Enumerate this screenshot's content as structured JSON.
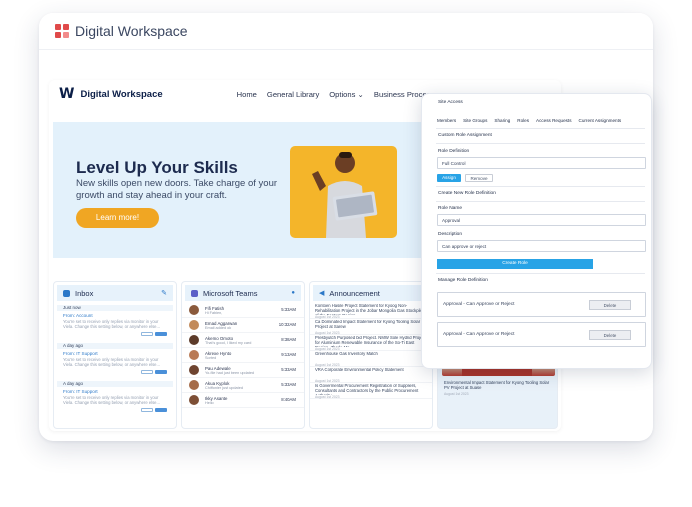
{
  "window": {
    "title": "Digital Workspace"
  },
  "nav": {
    "brand": "Digital Workspace",
    "links": [
      "Home",
      "General Library",
      "Options",
      "Business Processes"
    ]
  },
  "hero": {
    "title": "Level Up Your Skills",
    "subtitle": "New skills open new doors. Take charge of your growth and stay ahead in your craft.",
    "cta": "Learn more!"
  },
  "inbox": {
    "title": "Inbox",
    "groups": [
      {
        "header": "Just now",
        "from": "From: Account",
        "text": "You're set to receive only replies via monitor in your Viela. Change this setting below, or anywhere else..."
      },
      {
        "header": "A day ago",
        "from": "From: IT Support",
        "text": "You're set to receive only replies via monitor in your Viela. Change this setting below, or anywhere else..."
      },
      {
        "header": "A day ago",
        "from": "From: IT Support",
        "text": "You're set to receive only replies via monitor in your Viela. Change this setting below, or anywhere else..."
      }
    ]
  },
  "teams": {
    "title": "Microsoft Teams",
    "items": [
      {
        "name": "Fifi Fatish",
        "status": "Hi Fabien,",
        "time": "5:33AM"
      },
      {
        "name": "Emad Aggarwan",
        "status": "Email added ok",
        "time": "10:32AM"
      },
      {
        "name": "Akemo Omoto",
        "status": "That's good, I liked my card",
        "time": "8:38AM"
      },
      {
        "name": "Akrexe Hynto",
        "status": "Sorted",
        "time": "9:13AM"
      },
      {
        "name": "Pau Adewale",
        "status": "Yo-file had just been updated",
        "time": "5:33AM"
      },
      {
        "name": "Akua Kyplok",
        "status": "Chiffonier just updated",
        "time": "5:33AM"
      },
      {
        "name": "Ikky Asante",
        "status": "Hello",
        "time": "8:40AM"
      }
    ]
  },
  "announcement": {
    "title": "Announcement",
    "items": [
      {
        "text": "Kontoen Hasile Project Statement for Kyoog Non-Rehabilitation Project in the Jobar Mongolia Gas Stockpile of the Eastern Region",
        "date": "August 1st 2023"
      },
      {
        "text": "Ca Dominated Impact Statement for Kyong Tooling Solar PV Project at Sarew",
        "date": "August 1st 2023"
      },
      {
        "text": "Presbyutch Purposed bid Project. NMW Sole Hydrid Project for Aluminium Renewable Insurance of the So-Ti East Region. Zhode Mo...",
        "date": "August 1st 2023"
      },
      {
        "text": "Greenhouse Gas Inventory Match",
        "date": "August 1st 2023"
      },
      {
        "text": "VRA Corporate Environmental Policy Statement",
        "date": "August 1st 2023"
      },
      {
        "text": "Is Govermental Procurement Registration of Suppliers, Consultants and Contractors by the Public Procurement Authority",
        "date": "August 1st 2023"
      }
    ]
  },
  "news": {
    "caption": "Environmental Impact Statement for Kyong Tooling Solar PV Project at Suase",
    "date": "August 1st 2023"
  },
  "site_access": {
    "title": "Site Access",
    "tabs": [
      "Members",
      "Site Groups",
      "Sharing",
      "Roles",
      "Access Requests",
      "Current Assignments"
    ],
    "custom_heading": "Custom Role Assignment",
    "role_def_label": "Role Definition",
    "role_def_value": "Full Control",
    "assign": "Assign",
    "remove": "Remove",
    "create_heading": "Create New Role Definition",
    "role_name_label": "Role Name",
    "role_name_value": "Approval",
    "description_label": "Description",
    "description_value": "Can approve or reject",
    "create_btn": "Create Role",
    "manage_heading": "Manage Role Definition",
    "roles": [
      {
        "text": "Approval - Can Approve or Reject",
        "delete": "Delete"
      },
      {
        "text": "Approval - Can Approve or Reject",
        "delete": "Delete"
      }
    ]
  }
}
